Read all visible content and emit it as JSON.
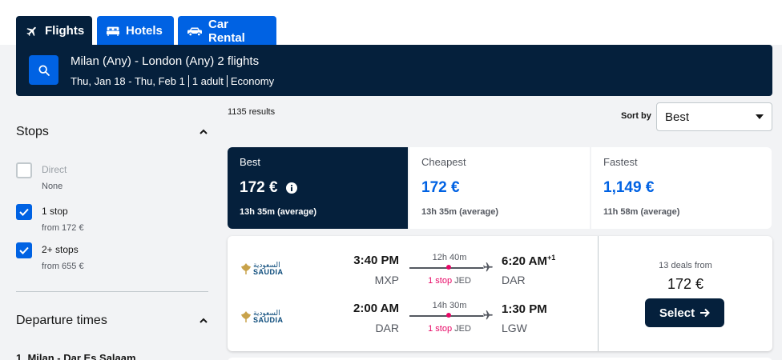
{
  "tabs": {
    "flights": "Flights",
    "hotels": "Hotels",
    "car_rental": "Car Rental"
  },
  "search": {
    "route": "Milan (Any) - London (Any) 2 flights",
    "dates": "Thu, Jan 18 - Thu, Feb 1",
    "travelers": "1 adult",
    "cabin": "Economy"
  },
  "sidebar": {
    "stops_title": "Stops",
    "options": [
      {
        "label": "Direct",
        "sub": "None",
        "checked": false
      },
      {
        "label": "1 stop",
        "sub": "from 172 €",
        "checked": true
      },
      {
        "label": "2+ stops",
        "sub": "from 655 €",
        "checked": true
      }
    ],
    "departure_title": "Departure times",
    "departure_leg": "1. Milan - Dar Es Salaam"
  },
  "results": {
    "count": "1135 results",
    "sort_label": "Sort by",
    "sort_value": "Best"
  },
  "sort_tabs": [
    {
      "label": "Best",
      "price": "172 €",
      "duration": "13h 35m (average)"
    },
    {
      "label": "Cheapest",
      "price": "172 €",
      "duration": "13h 35m (average)"
    },
    {
      "label": "Fastest",
      "price": "1,149 €",
      "duration": "11h 58m (average)"
    }
  ],
  "card": {
    "airline_ar": "السعودية",
    "airline_en": "SAUDIA",
    "legs": [
      {
        "dep_time": "3:40 PM",
        "dep_code": "MXP",
        "duration": "12h 40m",
        "stops": "1 stop",
        "via": "JED",
        "arr_time": "6:20 AM",
        "arr_sup": "+1",
        "arr_code": "DAR"
      },
      {
        "dep_time": "2:00 AM",
        "dep_code": "DAR",
        "duration": "14h 30m",
        "stops": "1 stop",
        "via": "JED",
        "arr_time": "1:30 PM",
        "arr_sup": "",
        "arr_code": "LGW"
      }
    ],
    "deals": "13 deals from",
    "price": "172 €",
    "select_label": "Select"
  },
  "colors": {
    "navy": "#05203c",
    "blue": "#0062e3",
    "stop_pink": "#e70866"
  }
}
